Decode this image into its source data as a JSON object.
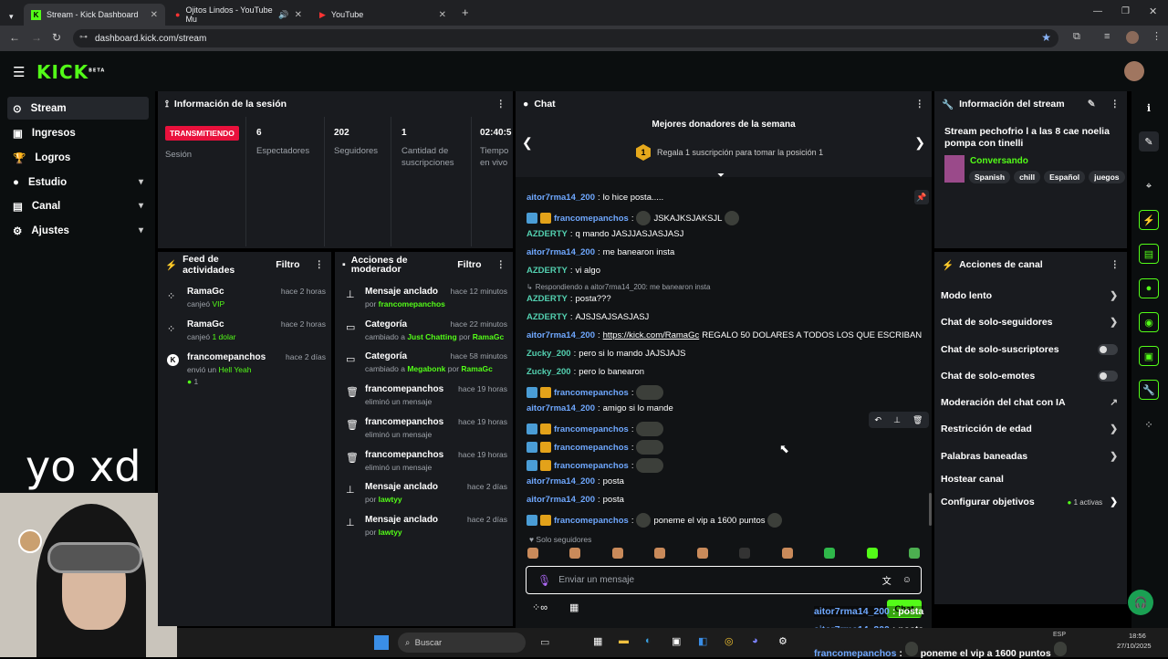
{
  "browser": {
    "tabs": [
      {
        "label": "Stream - Kick Dashboard"
      },
      {
        "label": "Ojitos Lindos - YouTube Mu"
      },
      {
        "label": "YouTube"
      }
    ],
    "url": "dashboard.kick.com/stream"
  },
  "header": {
    "logo": "KICK",
    "beta": "BETA"
  },
  "sidebar": {
    "items": [
      {
        "label": "Stream"
      },
      {
        "label": "Ingresos"
      },
      {
        "label": "Logros"
      },
      {
        "label": "Estudio"
      },
      {
        "label": "Canal"
      },
      {
        "label": "Ajustes"
      }
    ]
  },
  "overlay_text": "yo xd",
  "session": {
    "title": "Información de la sesión",
    "live_badge": "TRANSMITIENDO",
    "live_label": "Sesión",
    "stats": [
      {
        "value": "6",
        "label": "Espectadores"
      },
      {
        "value": "202",
        "label": "Seguidores"
      },
      {
        "value": "1",
        "label": "Cantidad de suscripciones"
      },
      {
        "value": "02:40:5",
        "label": "Tiempo en vivo"
      }
    ]
  },
  "feed": {
    "title": "Feed de actividades",
    "filter": "Filtro",
    "items": [
      {
        "name": "RamaGc",
        "action": "canjeó",
        "highlight": "VIP",
        "time": "hace 2 horas"
      },
      {
        "name": "RamaGc",
        "action": "canjeó",
        "highlight": "1 dolar",
        "time": "hace 2 horas"
      },
      {
        "name": "francomepanchos",
        "action": "envió un",
        "highlight": "Hell Yeah",
        "extra": "1",
        "time": "hace 2 días"
      }
    ]
  },
  "mod": {
    "title": "Acciones de moderador",
    "filter": "Filtro",
    "items": [
      {
        "title": "Mensaje anclado",
        "sub": "por",
        "who": "francomepanchos",
        "time": "hace 12 minutos"
      },
      {
        "title": "Categoría",
        "sub": "cambiado a",
        "cat": "Just Chatting",
        "by": "por",
        "who": "RamaGc",
        "time": "hace 22 minutos"
      },
      {
        "title": "Categoría",
        "sub": "cambiado a",
        "cat": "Megabonk",
        "by": "por",
        "who": "RamaGc",
        "time": "hace 58 minutos"
      },
      {
        "title": "francomepanchos",
        "sub": "eliminó un mensaje",
        "time": "hace 19 horas"
      },
      {
        "title": "francomepanchos",
        "sub": "eliminó un mensaje",
        "time": "hace 19 horas"
      },
      {
        "title": "francomepanchos",
        "sub": "eliminó un mensaje",
        "time": "hace 19 horas"
      },
      {
        "title": "Mensaje anclado",
        "sub": "por",
        "who": "lawtyy",
        "time": "hace 2 días"
      },
      {
        "title": "Mensaje anclado",
        "sub": "por",
        "who": "lawtyy",
        "time": "hace 2 días"
      }
    ]
  },
  "chat": {
    "title": "Chat",
    "donors_title": "Mejores donadores de la semana",
    "donors_rank": "1",
    "donors_text": "Regala 1 suscripción para tomar la posición 1",
    "messages": [
      {
        "user": "aitor7rma14_200",
        "text": "lo hice posta....."
      },
      {
        "user": "francomepanchos",
        "text": "JSKAJKSJAKSJL"
      },
      {
        "user": "AZDERTY",
        "text": "q mando JASJJASJASJASJ"
      },
      {
        "user": "aitor7rma14_200",
        "text": "me banearon insta"
      },
      {
        "user": "AZDERTY",
        "text": "vi algo"
      },
      {
        "reply": "Respondiendo a aitor7rma14_200: me banearon insta",
        "user": "AZDERTY",
        "text": "posta???"
      },
      {
        "user": "AZDERTY",
        "text": "AJSJSAJSASJASJ"
      },
      {
        "user": "aitor7rma14_200",
        "link": "https://kick.com/RamaGc",
        "text": "REGALO 50 DOLARES A TODOS LOS QUE ESCRIBAN"
      },
      {
        "user": "Zucky_200",
        "text": "pero si lo mando JAJSJAJS"
      },
      {
        "user": "Zucky_200",
        "text": "pero lo banearon"
      },
      {
        "user": "francomepanchos",
        "text": ""
      },
      {
        "user": "aitor7rma14_200",
        "text": "amigo si lo mande"
      },
      {
        "user": "francomepanchos",
        "text": ""
      },
      {
        "user": "francomepanchos",
        "text": ""
      },
      {
        "user": "francomepanchos",
        "text": ""
      },
      {
        "user": "aitor7rma14_200",
        "text": "posta"
      },
      {
        "user": "aitor7rma14_200",
        "text": "posta"
      },
      {
        "user": "francomepanchos",
        "text": "poneme el vip a 1600 puntos"
      }
    ],
    "followers_only": "Solo seguidores",
    "input_placeholder": "Enviar un mensaje",
    "send": "Chat"
  },
  "stream_info": {
    "title": "Información del stream",
    "stream_title": "Stream pechofrio l a las 8 cae noelia pompa con tinelli",
    "category": "Conversando",
    "tags": [
      "Spanish",
      "chill",
      "Español",
      "juegos"
    ]
  },
  "channel_actions": {
    "title": "Acciones de canal",
    "items": [
      {
        "label": "Modo lento",
        "kind": "chevron"
      },
      {
        "label": "Chat de solo-seguidores",
        "kind": "chevron"
      },
      {
        "label": "Chat de solo-suscriptores",
        "kind": "toggle"
      },
      {
        "label": "Chat de solo-emotes",
        "kind": "toggle"
      },
      {
        "label": "Moderación del chat con IA",
        "kind": "external"
      },
      {
        "label": "Restricción de edad",
        "kind": "chevron"
      },
      {
        "label": "Palabras baneadas",
        "kind": "chevron"
      },
      {
        "label": "Hostear canal",
        "kind": "none"
      },
      {
        "label": "Configurar objetivos",
        "kind": "chevron",
        "extra": "1 activas"
      }
    ]
  },
  "overlay_chat": [
    {
      "user": "aitor7rma14_200",
      "text": "posta"
    },
    {
      "user": "aitor7rma14_200",
      "text": "posta"
    },
    {
      "user": "francomepanchos",
      "text": "poneme el vip a 1600 puntos"
    }
  ],
  "taskbar": {
    "search": "Buscar",
    "lang": "ESP",
    "time": "18:56",
    "date": "27/10/2025"
  }
}
